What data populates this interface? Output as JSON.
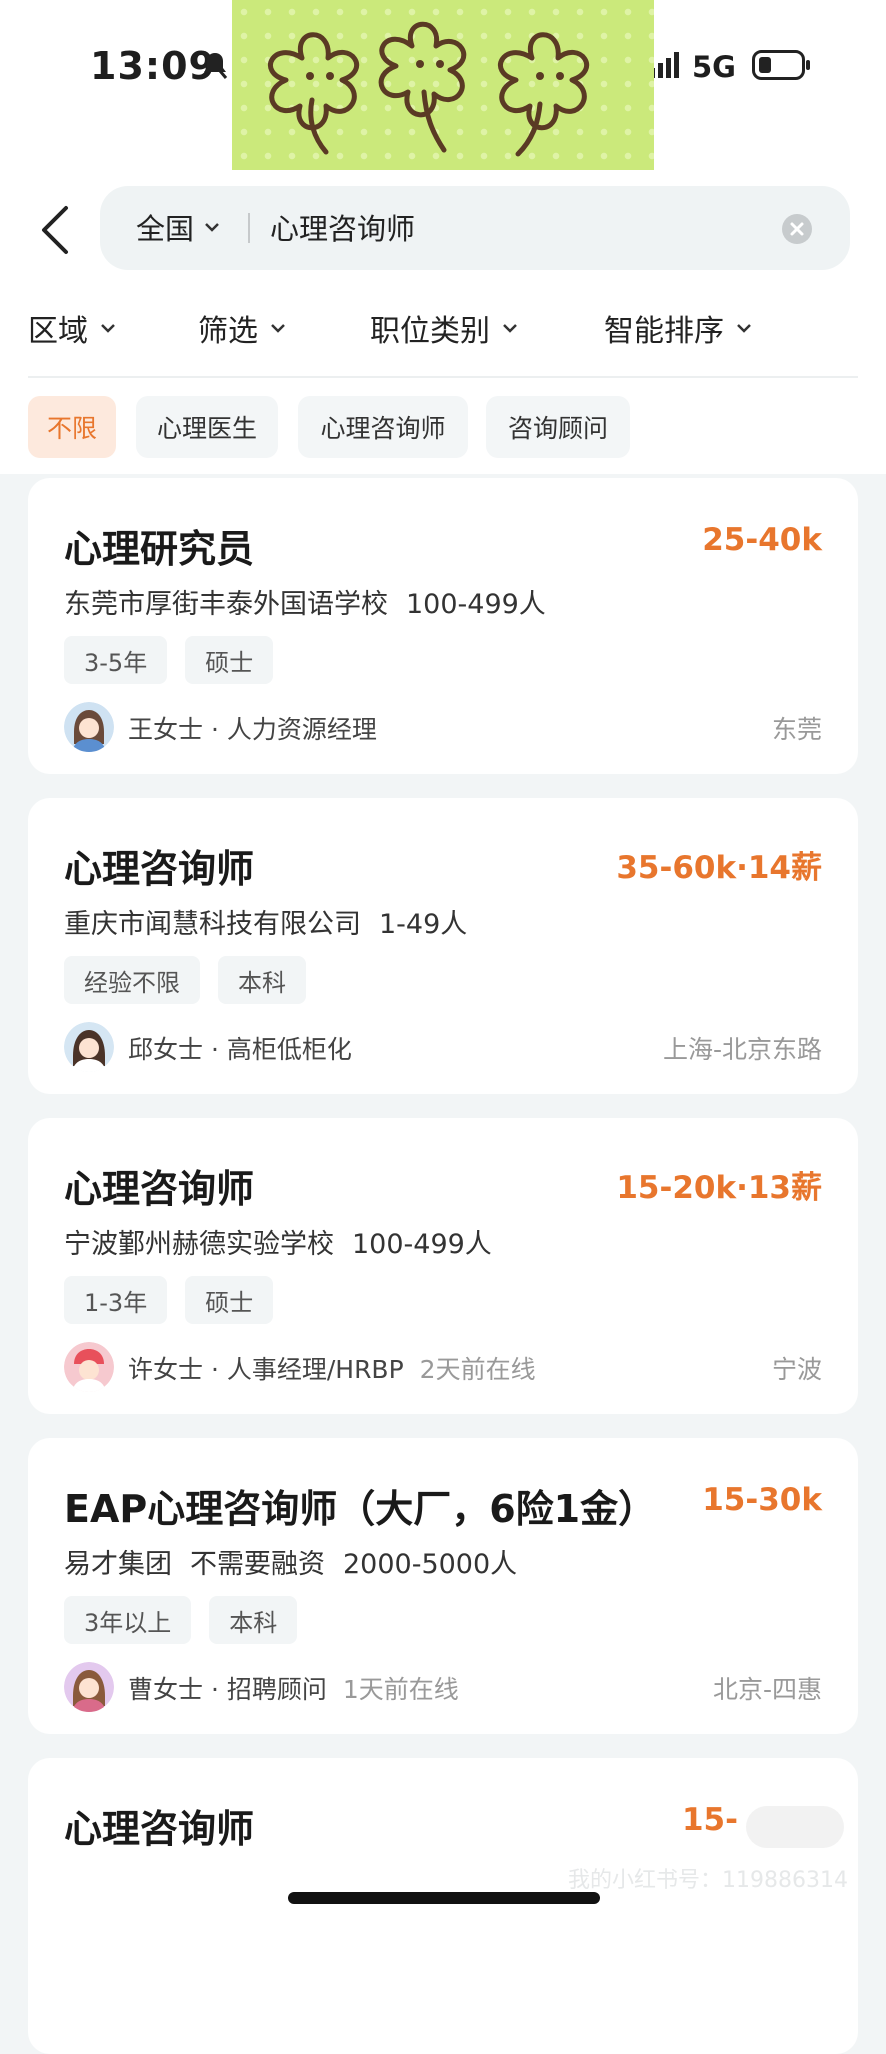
{
  "status_bar": {
    "time": "13:09",
    "network": "5G"
  },
  "header": {
    "region": "全国",
    "query": "心理咨询师"
  },
  "filters": [
    {
      "label": "区域"
    },
    {
      "label": "筛选"
    },
    {
      "label": "职位类别"
    },
    {
      "label": "智能排序"
    }
  ],
  "chips": [
    {
      "label": "不限",
      "active": true
    },
    {
      "label": "心理医生",
      "active": false
    },
    {
      "label": "心理咨询师",
      "active": false
    },
    {
      "label": "咨询顾问",
      "active": false
    }
  ],
  "jobs": [
    {
      "title": "心理研究员",
      "salary": "25-40k",
      "company": "东莞市厚街丰泰外国语学校",
      "size": "100-499人",
      "funding": "",
      "tags": [
        "3-5年",
        "硕士"
      ],
      "recruiter": "王女士 · 人力资源经理",
      "online": "",
      "location": "东莞"
    },
    {
      "title": "心理咨询师",
      "salary": "35-60k·14薪",
      "company": "重庆市闻慧科技有限公司",
      "size": "1-49人",
      "funding": "",
      "tags": [
        "经验不限",
        "本科"
      ],
      "recruiter": "邱女士 · 高柜低柜化",
      "online": "",
      "location": "上海-北京东路"
    },
    {
      "title": "心理咨询师",
      "salary": "15-20k·13薪",
      "company": "宁波鄞州赫德实验学校",
      "size": "100-499人",
      "funding": "",
      "tags": [
        "1-3年",
        "硕士"
      ],
      "recruiter": "许女士 · 人事经理/HRBP",
      "online": "2天前在线",
      "location": "宁波"
    },
    {
      "title": "EAP心理咨询师（大厂，6险1金）",
      "salary": "15-30k",
      "company": "易才集团",
      "size": "2000-5000人",
      "funding": "不需要融资",
      "tags": [
        "3年以上",
        "本科"
      ],
      "recruiter": "曹女士 · 招聘顾问",
      "online": "1天前在线",
      "location": "北京-四惠"
    },
    {
      "title": "心理咨询师",
      "salary": "15-",
      "company": "",
      "size": "",
      "funding": "",
      "tags": [],
      "recruiter": "",
      "online": "",
      "location": ""
    }
  ],
  "watermark": "我的小红书号：119886314",
  "colors": {
    "accent": "#e8762d",
    "background": "#f2f5f6",
    "sticker": "#cbe97b"
  }
}
